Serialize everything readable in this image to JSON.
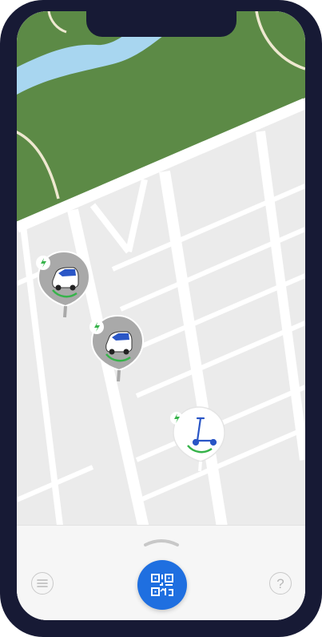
{
  "colors": {
    "park": "#5c8a46",
    "river": "#a8d6f0",
    "road": "#ffffff",
    "ground": "#ebebeb",
    "pin_gray": "#a9a9a9",
    "pin_white": "#ffffff",
    "charge_green": "#36b34a",
    "accent_blue": "#1f6fe0"
  },
  "map": {
    "vehicles": [
      {
        "type": "car",
        "icon": "electric-car-icon",
        "charging": true
      },
      {
        "type": "car",
        "icon": "electric-car-icon",
        "charging": true
      },
      {
        "type": "scooter",
        "icon": "kick-scooter-icon",
        "charging": true
      }
    ]
  },
  "bottom_bar": {
    "menu_icon": "menu-icon",
    "scan_icon": "qr-scan-icon",
    "help_icon": "help-icon",
    "help_glyph": "?"
  }
}
